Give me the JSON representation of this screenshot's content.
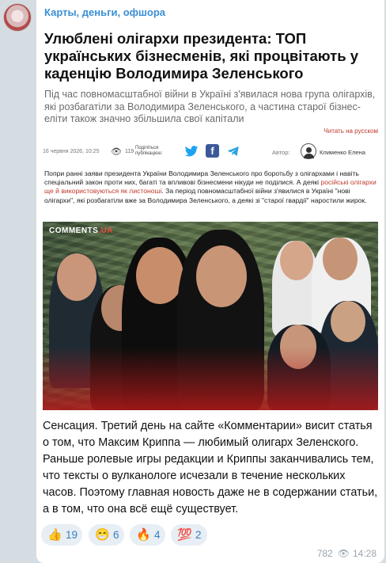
{
  "channel": {
    "name": "Карты, деньги, офшора"
  },
  "article": {
    "headline": "Улюблені олігархи президента: ТОП українських бізнесменів, які процвітають у каденцію Володимира Зеленського",
    "lead": "Під час повномасштабної війни в Україні з'явилася нова група олігархів, які розбагатіли за Володимира Зеленського, а частина старої бізнес-еліти також значно збільшила свої капітали",
    "lang_link": "Читать на русском",
    "date": "16 червня 2026, 10:25",
    "views": "119",
    "share_label": "Поділіться публікацією:",
    "author_label": "Автор:",
    "author": "Клименко Елена",
    "body_part1": "Попри ранні заяви президента України Володимира Зеленського про боротьбу з олігархами і навіть спеціальний закон проти них, багаті та впливові бізнесмени нікуди не поділися. А деякі ",
    "body_highlight": "російські олігархи ще й використовуються як листоноші",
    "body_part2": ". За період повномасштабної війни з'явилися в Україні \"нові олігархи\", які розбагатіли вже за Володимира Зеленського, а деякі зі \"старої гвардії\" наростили жирок.",
    "photo_logo_main": "COMMENTS",
    "photo_logo_ua": ".UA"
  },
  "message": {
    "text": "Сенсация. Третий день на сайте «Комментарии» висит статья о том, что Максим Криппа — любимый олигарх Зеленского. Раньше ролевые игры редакции и Криппы заканчивались тем, что тексты о вулканологе исчезали в течение нескольких часов. Поэтому главная новость даже не в содержании статьи, а в том, что она всё ещё существует."
  },
  "reactions": [
    {
      "emoji": "👍",
      "count": "19"
    },
    {
      "emoji": "😁",
      "count": "6"
    },
    {
      "emoji": "🔥",
      "count": "4"
    },
    {
      "emoji": "💯",
      "count": "2"
    }
  ],
  "footer": {
    "views": "782",
    "time": "14:28"
  },
  "colors": {
    "channel_name": "#3a8fd4",
    "reaction_bg": "#e7eef4",
    "highlight": "#c0392b"
  }
}
